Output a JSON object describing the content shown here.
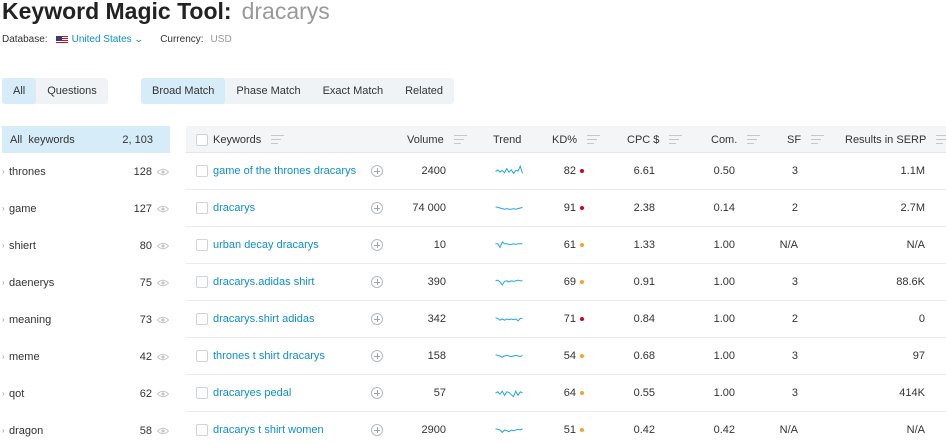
{
  "header": {
    "title": "Keyword Magic Tool:",
    "query": "dracarys",
    "database_label": "Database:",
    "database_value": "United States",
    "currency_label": "Currency:",
    "currency_value": "USD"
  },
  "filter_tabs": [
    {
      "label": "All",
      "active": true
    },
    {
      "label": "Questions",
      "active": false
    }
  ],
  "match_tabs": [
    {
      "label": "Broad Match",
      "active": true
    },
    {
      "label": "Phase Match",
      "active": false
    },
    {
      "label": "Exact Match",
      "active": false
    },
    {
      "label": "Related",
      "active": false
    }
  ],
  "sidebar": {
    "all_label": "All  keywords",
    "all_count": "2, 103",
    "groups": [
      {
        "label": "thrones",
        "count": "128"
      },
      {
        "label": "game",
        "count": "127"
      },
      {
        "label": "shiert",
        "count": "80"
      },
      {
        "label": "daenerys",
        "count": "75"
      },
      {
        "label": "meaning",
        "count": "73"
      },
      {
        "label": "meme",
        "count": "42"
      },
      {
        "label": "qot",
        "count": "62"
      },
      {
        "label": "dragon",
        "count": "58"
      }
    ]
  },
  "table": {
    "columns": {
      "keywords": "Keywords",
      "volume": "Volume",
      "trend": "Trend",
      "kd": "KD%",
      "cpc": "CPC $",
      "com": "Com.",
      "sf": "SF",
      "results": "Results in SERP"
    },
    "rows": [
      {
        "keyword": "game of the thrones dracarys",
        "volume": "2400",
        "trend": [
          0.45,
          0.6,
          0.4,
          0.55,
          0.35,
          0.7,
          0.4,
          0.6,
          0.3,
          0.55,
          0.5,
          0.9,
          0.3
        ],
        "kd": "82",
        "kd_color": "#d0021b",
        "cpc": "6.61",
        "com": "0.50",
        "sf": "3",
        "results": "1.1M"
      },
      {
        "keyword": "dracarys",
        "volume": "74 000",
        "trend": [
          0.6,
          0.55,
          0.5,
          0.45,
          0.4,
          0.45,
          0.4,
          0.4,
          0.45,
          0.4,
          0.45,
          0.5,
          0.55
        ],
        "kd": "91",
        "kd_color": "#d0021b",
        "cpc": "2.38",
        "com": "0.14",
        "sf": "2",
        "results": "2.7M"
      },
      {
        "keyword": "urban decay dracarys",
        "volume": "10",
        "trend": [
          0.6,
          0.6,
          0.3,
          0.75,
          0.6,
          0.6,
          0.55,
          0.55,
          0.6,
          0.55,
          0.6,
          0.6,
          0.6
        ],
        "kd": "61",
        "kd_color": "#f5a623",
        "cpc": "1.33",
        "com": "1.00",
        "sf": "N/A",
        "results": "N/A"
      },
      {
        "keyword": "dracarys.adidas shirt",
        "volume": "390",
        "trend": [
          0.6,
          0.65,
          0.5,
          0.25,
          0.55,
          0.6,
          0.5,
          0.6,
          0.55,
          0.6,
          0.65,
          0.6,
          0.6
        ],
        "kd": "69",
        "kd_color": "#f5a623",
        "cpc": "0.91",
        "com": "1.00",
        "sf": "3",
        "results": "88.6K"
      },
      {
        "keyword": "dracarys.shirt adidas",
        "volume": "342",
        "trend": [
          0.6,
          0.55,
          0.4,
          0.5,
          0.4,
          0.5,
          0.45,
          0.5,
          0.45,
          0.5,
          0.35,
          0.55,
          0.55
        ],
        "kd": "71",
        "kd_color": "#d0021b",
        "cpc": "0.84",
        "com": "1.00",
        "sf": "2",
        "results": "0"
      },
      {
        "keyword": "thrones t shirt dracarys",
        "volume": "158",
        "trend": [
          0.6,
          0.55,
          0.5,
          0.4,
          0.5,
          0.55,
          0.5,
          0.45,
          0.5,
          0.55,
          0.5,
          0.45,
          0.55
        ],
        "kd": "54",
        "kd_color": "#f5a623",
        "cpc": "0.68",
        "com": "1.00",
        "sf": "3",
        "results": "97"
      },
      {
        "keyword": "dracaryes pedal",
        "volume": "57",
        "trend": [
          0.5,
          0.6,
          0.4,
          0.65,
          0.3,
          0.6,
          0.55,
          0.35,
          0.2,
          0.65,
          0.3,
          0.6,
          0.5
        ],
        "kd": "64",
        "kd_color": "#f5a623",
        "cpc": "0.55",
        "com": "1.00",
        "sf": "3",
        "results": "414K"
      },
      {
        "keyword": "dracarys t shirt women",
        "volume": "2900",
        "trend": [
          0.6,
          0.55,
          0.5,
          0.3,
          0.5,
          0.45,
          0.35,
          0.5,
          0.45,
          0.5,
          0.55,
          0.5,
          0.6
        ],
        "kd": "51",
        "kd_color": "#f5a623",
        "cpc": "0.42",
        "com": "0.42",
        "sf": "N/A",
        "results": "N/A"
      }
    ]
  },
  "colors": {
    "accent": "#0e8ecc",
    "active_tab_bg": "#d6ecf9",
    "trend_line": "#1fa8e0"
  }
}
